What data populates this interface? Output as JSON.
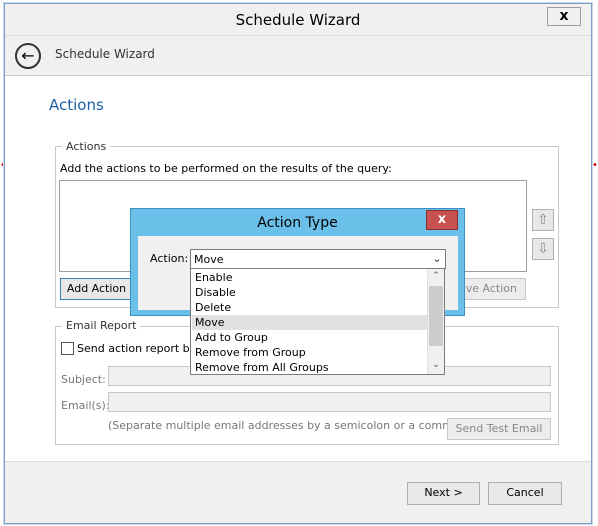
{
  "wizard": {
    "title": "Schedule Wizard",
    "close_label": "x",
    "header_title": "Schedule Wizard",
    "page_heading": "Actions"
  },
  "actions_group": {
    "legend": "Actions",
    "instructions": "Add the actions to be performed on the results of the query:",
    "add_action_label": "Add Action",
    "remove_action_label": "ove Action"
  },
  "email_group": {
    "legend": "Email Report",
    "send_checkbox_label": "Send action report by e",
    "subject_label": "Subject:",
    "emails_label": "Email(s):",
    "hint": "(Separate multiple email addresses by a semicolon or a comma)",
    "send_test_label": "Send Test Email"
  },
  "footer": {
    "next_label": "Next >",
    "cancel_label": "Cancel"
  },
  "dialog": {
    "title": "Action Type",
    "close_label": "x",
    "action_label": "Action:",
    "selected_value": "Move",
    "options": [
      "Enable",
      "Disable",
      "Delete",
      "Move",
      "Add to Group",
      "Remove from Group",
      "Remove from All Groups"
    ],
    "selected_index": 3
  },
  "colors": {
    "dialog_title_bg": "#6ac0e8",
    "close_red": "#c75050",
    "heading_blue": "#1f5fa6"
  }
}
